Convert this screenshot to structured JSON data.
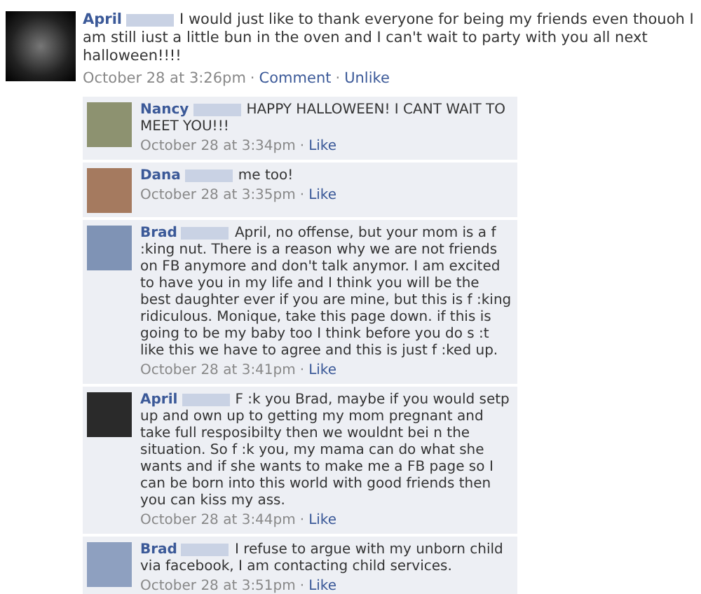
{
  "post": {
    "author": "April",
    "text": "I would just like to thank everyone for being my friends even thouoh I am still iust a little bun in the oven and I can't wait to party with you all next halloween!!!!",
    "time": "October 28 at 3:26pm",
    "separator": "·",
    "actions": [
      "Comment",
      "Unlike"
    ]
  },
  "comments": [
    {
      "author": "Nancy",
      "text": "HAPPY HALLOWEEN! I CANT WAIT TO MEET YOU!!!",
      "time": "October 28 at 3:34pm",
      "separator": "·",
      "action": "Like"
    },
    {
      "author": "Dana",
      "text": "me too!",
      "time": "October 28 at 3:35pm",
      "separator": "·",
      "action": "Like"
    },
    {
      "author": "Brad",
      "text": "April, no offense, but your mom is a f :king nut. There is a reason why we are not friends on FB anymore and don't talk anymor. I am excited to have you in my life and I think you will be the best daughter ever if you are mine, but this is f :king ridiculous. Monique, take this page down. if this is going to be my baby too I think before you do s :t like this we have to agree and this is just f :ked up.",
      "time": "October 28 at 3:41pm",
      "separator": "·",
      "action": "Like"
    },
    {
      "author": "April",
      "text": "F :k you Brad, maybe if you would setp up and own up to getting my mom pregnant and take full resposibilty then we wouldnt bei n the situation. So f :k you, my mama can do what she wants and if she wants to make me a FB page so I can be born into this world with good friends then you can kiss my ass.",
      "time": "October 28 at 3:44pm",
      "separator": "·",
      "action": "Like"
    },
    {
      "author": "Brad",
      "text": "I refuse to argue with my unborn child via facebook, I am contacting child services.",
      "time": "October 28 at 3:51pm",
      "separator": "·",
      "action": "Like"
    }
  ]
}
